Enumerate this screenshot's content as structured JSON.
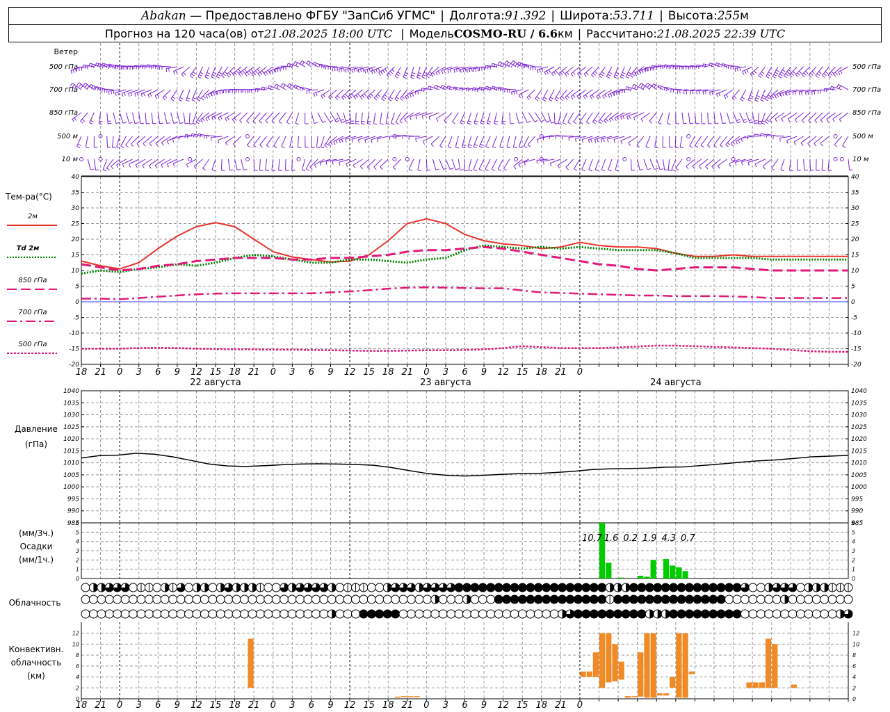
{
  "header": {
    "station": "Abakan",
    "dash": " — ",
    "provider": "Предоставлено ФГБУ \"ЗапСиб УГМС\"",
    "lon_label": "Долгота:",
    "lon": "91.392",
    "lat_label": "Широта:",
    "lat": "53.711",
    "alt_label": "Высота:",
    "alt": "255",
    "alt_unit": "м",
    "forecast_prefix": "Прогноз на 120 часа(ов) от",
    "forecast_from": "21.08.2025 18:00 UTC",
    "model_label": "Модель",
    "model": "COSMO-RU / 6.6",
    "model_unit": "км",
    "calc_label": "Рассчитано:",
    "calc_time": "21.08.2025 22:39 UTC"
  },
  "colors": {
    "t2m": "#e8342c",
    "td": "#008000",
    "t850": "#e0197a",
    "t700": "#e0197a",
    "t500": "#e0197a",
    "wind": "#7a1fd6",
    "precip": "#00cc00",
    "conv": "#f08a24",
    "pressure": "#000000"
  },
  "chart_data": [
    {
      "type": "barbs",
      "panel": "wind",
      "title": "Ветер",
      "levels": [
        "500 гПа",
        "700 гПа",
        "850 гПа",
        "500 м",
        "10 м"
      ]
    },
    {
      "type": "line",
      "panel": "temperature",
      "ylabel": "Тем-ра(°C)",
      "ylim": [
        -20,
        40
      ],
      "yticks": [
        40,
        35,
        30,
        25,
        20,
        15,
        10,
        5,
        0,
        -5,
        -10,
        -15,
        -20
      ],
      "x_hours": [
        0,
        3,
        6,
        9,
        12,
        15,
        18,
        21,
        24,
        27,
        30,
        33,
        36,
        39,
        42,
        45,
        48,
        51,
        54,
        57,
        60,
        63,
        66,
        69,
        72,
        75,
        78,
        81,
        84,
        87,
        90,
        93,
        96,
        99,
        102,
        105,
        108,
        111,
        114,
        117,
        120
      ],
      "x_tick_labels": [
        "18",
        "21",
        "0",
        "3",
        "6",
        "9",
        "12",
        "15",
        "18",
        "21",
        "0",
        "3",
        "6",
        "9",
        "12",
        "15",
        "18",
        "21",
        "0",
        "3",
        "6",
        "9",
        "12",
        "15",
        "18",
        "21",
        "0"
      ],
      "date_labels": [
        "22 августа",
        "23 августа",
        "24 августа"
      ],
      "series": [
        {
          "name": "2м",
          "style": "solid",
          "values": [
            13,
            11.5,
            10.5,
            12.5,
            17,
            21,
            24,
            25.3,
            24,
            20,
            16,
            14.3,
            13.5,
            12.7,
            13,
            15,
            19.5,
            25,
            26.5,
            25,
            21.5,
            19.5,
            18.5,
            18,
            17,
            17.5,
            19,
            18,
            17.5,
            17.5,
            17,
            15.5,
            14.5,
            14.5,
            15,
            14.5,
            14.5,
            14.5,
            14.5,
            14.5,
            14.5
          ]
        },
        {
          "name": "Td 2м",
          "style": "dotted",
          "values": [
            9,
            10,
            9.5,
            10.5,
            11,
            12,
            11.5,
            12.5,
            14,
            15,
            14.5,
            13.5,
            12.5,
            12.5,
            13.5,
            13.5,
            13,
            12.5,
            13.5,
            14,
            16.5,
            18,
            17.5,
            17,
            17.5,
            17,
            17.5,
            17,
            16.5,
            16.5,
            16.5,
            15.5,
            14,
            14,
            14,
            14,
            13.5,
            13.5,
            13.5,
            13.5,
            13.5
          ]
        },
        {
          "name": "850 гПа",
          "style": "dashed",
          "values": [
            12,
            11,
            10,
            10.5,
            11.5,
            12,
            13,
            13.5,
            14,
            14,
            14,
            13.5,
            13.5,
            14,
            14,
            14.5,
            15,
            16,
            16.5,
            16.5,
            17,
            17.5,
            17,
            16,
            15,
            14,
            13,
            12,
            11.5,
            10.5,
            10,
            10.5,
            11,
            11,
            11,
            10.5,
            10,
            10,
            10,
            10,
            10
          ]
        },
        {
          "name": "700 гПа",
          "style": "dashdot",
          "values": [
            1,
            1,
            0.8,
            1.2,
            1.6,
            2,
            2.4,
            2.6,
            2.7,
            2.7,
            2.7,
            2.7,
            2.7,
            3,
            3.3,
            3.7,
            4.2,
            4.5,
            4.6,
            4.5,
            4.4,
            4.3,
            4.3,
            3.6,
            3,
            2.8,
            2.6,
            2.4,
            2.2,
            2,
            2,
            1.8,
            1.8,
            1.8,
            1.7,
            1.5,
            1.2,
            1.2,
            1.2,
            1.2,
            1.2
          ]
        },
        {
          "name": "500 гПа",
          "style": "densedash",
          "values": [
            -15,
            -15,
            -15,
            -14.8,
            -14.7,
            -14.8,
            -15,
            -15.1,
            -15.2,
            -15.2,
            -15.3,
            -15.3,
            -15.4,
            -15.5,
            -15.6,
            -15.7,
            -15.7,
            -15.6,
            -15.5,
            -15.5,
            -15.4,
            -15.2,
            -14.8,
            -14.2,
            -14.5,
            -14.8,
            -14.8,
            -14.8,
            -14.6,
            -14.3,
            -14,
            -14,
            -14.2,
            -14.4,
            -14.6,
            -14.8,
            -15,
            -15.4,
            -15.8,
            -16,
            -16
          ]
        }
      ],
      "legend_labels": [
        "2м",
        "Td  2м",
        "850 гПа",
        "700 гПа",
        "500 гПа"
      ]
    },
    {
      "type": "line",
      "panel": "pressure",
      "ylabel": "Давление",
      "yunit": "(гПа)",
      "ylim": [
        985,
        1040
      ],
      "yticks": [
        1040,
        1035,
        1030,
        1025,
        1020,
        1015,
        1010,
        1005,
        1000,
        995,
        990,
        985
      ],
      "series": [
        {
          "name": "давление",
          "values": [
            1012,
            1013,
            1013.2,
            1014,
            1013.6,
            1012.5,
            1011,
            1009.5,
            1008.7,
            1008.5,
            1008.8,
            1009.2,
            1009.5,
            1009.6,
            1009.5,
            1009.3,
            1009,
            1008,
            1006.7,
            1005.5,
            1004.8,
            1004.5,
            1004.8,
            1005.2,
            1005.5,
            1005.6,
            1006,
            1006.5,
            1007.2,
            1007.5,
            1007.6,
            1007.8,
            1008.2,
            1008.3,
            1008.9,
            1009.5,
            1010.2,
            1010.8,
            1011.2,
            1011.8,
            1012.5,
            1012.8,
            1013.1
          ]
        }
      ]
    },
    {
      "type": "bar",
      "panel": "precipitation",
      "ylabel_lines": [
        "(мм/3ч.)",
        "Осадки",
        "(мм/1ч.)"
      ],
      "ylim": [
        0,
        6
      ],
      "yticks": [
        0,
        1,
        2,
        3,
        4,
        5,
        6
      ],
      "bars": [
        {
          "hour": 81.5,
          "value": 6.0
        },
        {
          "hour": 82.5,
          "value": 1.7
        },
        {
          "hour": 84.5,
          "value": 0.1
        },
        {
          "hour": 87.5,
          "value": 0.3
        },
        {
          "hour": 88.5,
          "value": 0.2
        },
        {
          "hour": 89.5,
          "value": 2.0
        },
        {
          "hour": 91.5,
          "value": 2.1
        },
        {
          "hour": 92.5,
          "value": 1.4
        },
        {
          "hour": 93.5,
          "value": 1.2
        },
        {
          "hour": 94.5,
          "value": 0.8
        }
      ],
      "sums": [
        {
          "hour": 81,
          "value": "10.7"
        },
        {
          "hour": 84,
          "value": "1.6"
        },
        {
          "hour": 87,
          "value": "0.2"
        },
        {
          "hour": 90,
          "value": "1.9"
        },
        {
          "hour": 93,
          "value": "4.3"
        },
        {
          "hour": 96,
          "value": "0.7"
        }
      ]
    },
    {
      "type": "symbols",
      "panel": "cloudiness",
      "ylabel": "Облачность",
      "cover_scale": "0=ясно, 1=малая, 2=половина, 3=значительная, 4=сплошная",
      "rows": [
        [
          0,
          2,
          2,
          3,
          3,
          3,
          0,
          1,
          1,
          0,
          2,
          1,
          3,
          0,
          2,
          2,
          0,
          2,
          3,
          2,
          2,
          2,
          1,
          0,
          0,
          3,
          2,
          3,
          3,
          3,
          3,
          2,
          0,
          1,
          1,
          1,
          0,
          0,
          2,
          3,
          3,
          3,
          2,
          3,
          3,
          3,
          3,
          4,
          4,
          4,
          4,
          4,
          4,
          4,
          4,
          4,
          4,
          4,
          4,
          4,
          4,
          4,
          4,
          4,
          4,
          4,
          2,
          2,
          2,
          4,
          4,
          4,
          4,
          4,
          4,
          4,
          4,
          4,
          4,
          4,
          4,
          4,
          4,
          3,
          0,
          0,
          2,
          3,
          3,
          3,
          0,
          2,
          2,
          2,
          1,
          1,
          1
        ],
        [
          0,
          0,
          0,
          0,
          0,
          0,
          0,
          0,
          0,
          0,
          0,
          0,
          0,
          0,
          0,
          0,
          0,
          0,
          0,
          0,
          0,
          0,
          0,
          0,
          0,
          0,
          0,
          0,
          0,
          0,
          0,
          0,
          0,
          0,
          0,
          0,
          0,
          0,
          0,
          0,
          0,
          0,
          0,
          0,
          2,
          0,
          0,
          0,
          2,
          0,
          0,
          0,
          4,
          4,
          4,
          4,
          4,
          4,
          4,
          4,
          4,
          4,
          4,
          4,
          4,
          4,
          1,
          4,
          4,
          4,
          4,
          4,
          4,
          4,
          4,
          4,
          4,
          4,
          4,
          4,
          4,
          0,
          0,
          0,
          0,
          0,
          0,
          0,
          2,
          0,
          0,
          0,
          0,
          0,
          0,
          0,
          0
        ],
        [
          0,
          0,
          0,
          0,
          0,
          0,
          0,
          0,
          0,
          0,
          0,
          0,
          0,
          0,
          0,
          0,
          0,
          0,
          0,
          0,
          0,
          0,
          0,
          0,
          0,
          0,
          0,
          0,
          0,
          0,
          0,
          2,
          0,
          0,
          0,
          4,
          4,
          4,
          4,
          4,
          0,
          0,
          0,
          0,
          0,
          0,
          0,
          0,
          0,
          0,
          0,
          0,
          0,
          0,
          0,
          0,
          0,
          0,
          0,
          0,
          2,
          3,
          4,
          4,
          4,
          4,
          4,
          4,
          4,
          4,
          4,
          2,
          2,
          2,
          4,
          4,
          4,
          4,
          4,
          4,
          4,
          4,
          4,
          0,
          0,
          0,
          0,
          0,
          0,
          0,
          0,
          0,
          0,
          0,
          0,
          2,
          3
        ]
      ]
    },
    {
      "type": "range_bar",
      "panel": "convective",
      "ylabel_lines": [
        "Конвективн.",
        "облачность",
        "(км)"
      ],
      "ylim": [
        0,
        14
      ],
      "yticks": [
        0,
        2,
        4,
        6,
        8,
        10,
        12
      ],
      "bars": [
        {
          "hour": 26.5,
          "base": 2.0,
          "top": 11.0
        },
        {
          "hour": 49.5,
          "base": 0.2,
          "top": 0.4
        },
        {
          "hour": 50.5,
          "base": 0.3,
          "top": 0.5
        },
        {
          "hour": 51.5,
          "base": 0.3,
          "top": 0.5
        },
        {
          "hour": 52.5,
          "base": 0.3,
          "top": 0.5
        },
        {
          "hour": 78.5,
          "base": 4.0,
          "top": 5.0
        },
        {
          "hour": 79.5,
          "base": 4.0,
          "top": 5.0
        },
        {
          "hour": 80.5,
          "base": 4.0,
          "top": 8.5
        },
        {
          "hour": 81.5,
          "base": 2.0,
          "top": 12.0
        },
        {
          "hour": 82.5,
          "base": 3.0,
          "top": 12.0
        },
        {
          "hour": 83.5,
          "base": 3.2,
          "top": 10.0
        },
        {
          "hour": 84.5,
          "base": 3.5,
          "top": 6.8
        },
        {
          "hour": 85.5,
          "base": 0.2,
          "top": 0.5
        },
        {
          "hour": 86.5,
          "base": 0.3,
          "top": 0.5
        },
        {
          "hour": 87.5,
          "base": 0.4,
          "top": 8.5
        },
        {
          "hour": 88.5,
          "base": 0.2,
          "top": 12.0
        },
        {
          "hour": 89.5,
          "base": 0.2,
          "top": 12.0
        },
        {
          "hour": 90.5,
          "base": 0.6,
          "top": 1.0
        },
        {
          "hour": 91.5,
          "base": 0.6,
          "top": 1.0
        },
        {
          "hour": 92.5,
          "base": 2.0,
          "top": 4.0
        },
        {
          "hour": 93.5,
          "base": 0.2,
          "top": 12.0
        },
        {
          "hour": 94.5,
          "base": 0.2,
          "top": 12.0
        },
        {
          "hour": 95.5,
          "base": 4.5,
          "top": 5.0
        },
        {
          "hour": 104.5,
          "base": 2.0,
          "top": 3.0
        },
        {
          "hour": 105.5,
          "base": 2.0,
          "top": 3.0
        },
        {
          "hour": 106.5,
          "base": 2.0,
          "top": 3.0
        },
        {
          "hour": 107.5,
          "base": 2.0,
          "top": 11.0
        },
        {
          "hour": 108.5,
          "base": 2.0,
          "top": 10.0
        },
        {
          "hour": 111.5,
          "base": 2.0,
          "top": 2.6
        }
      ]
    }
  ]
}
